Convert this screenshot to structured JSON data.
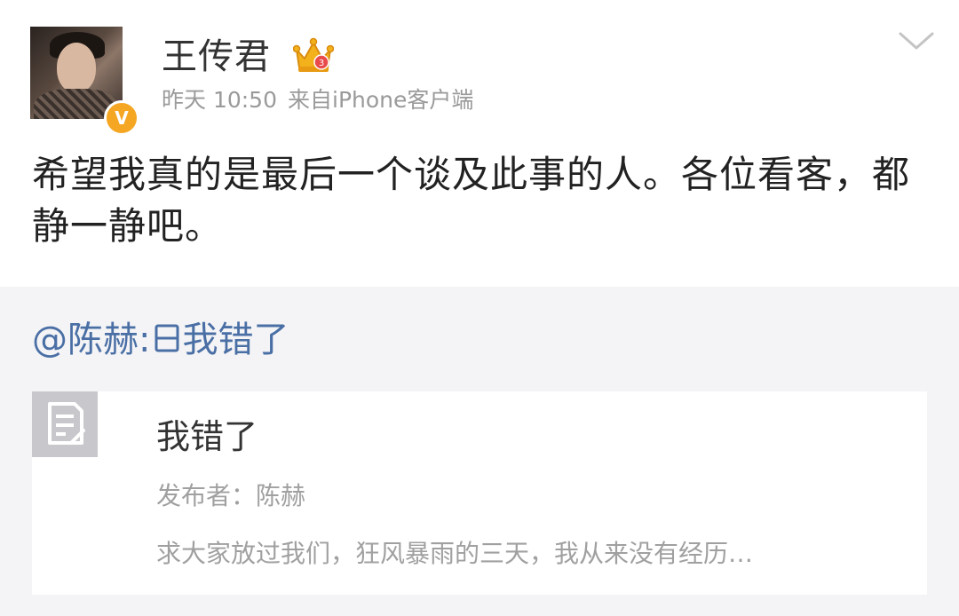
{
  "post": {
    "username": "王传君",
    "time": "昨天 10:50",
    "source": "来自iPhone客户端",
    "verified_badge": "V",
    "text": "希望我真的是最后一个谈及此事的人。各位看客，都静一静吧。"
  },
  "repost": {
    "mention": "@陈赫",
    "separator": ":",
    "text": "我错了",
    "card": {
      "title": "我错了",
      "author": "发布者：陈赫",
      "snippet": "求大家放过我们，狂风暴雨的三天，我从来没有经历…"
    }
  },
  "icons": {
    "avatar": "avatar",
    "verified": "verified-v-icon",
    "crown": "crown-icon",
    "menu": "chevron-down-icon",
    "article": "document-icon"
  },
  "colors": {
    "link": "#4a6fa5",
    "badge": "#f5a623",
    "meta": "#9a9a9a",
    "repost_bg": "#f4f4f6"
  }
}
